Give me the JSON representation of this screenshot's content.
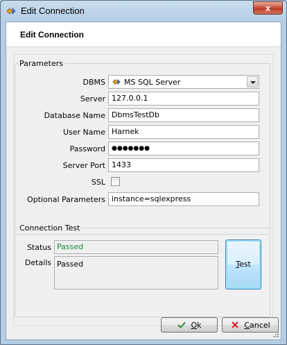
{
  "window": {
    "title": "Edit Connection",
    "close_label": "x"
  },
  "header": {
    "title": "Edit Connection"
  },
  "parameters": {
    "legend": "Parameters",
    "dbms": {
      "label": "DBMS",
      "value": "MS SQL Server"
    },
    "server": {
      "label": "Server",
      "value": "127.0.0.1"
    },
    "database_name": {
      "label": "Database Name",
      "value": "DbmsTestDb"
    },
    "user_name": {
      "label": "User Name",
      "value": "Harnek"
    },
    "password": {
      "label": "Password",
      "value": "●●●●●●●"
    },
    "server_port": {
      "label": "Server Port",
      "value": "1433"
    },
    "ssl": {
      "label": "SSL",
      "checked": false
    },
    "optional_parameters": {
      "label": "Optional Parameters",
      "value": "instance=sqlexpress"
    }
  },
  "connection_test": {
    "legend": "Connection Test",
    "status_label": "Status",
    "status_value": "Passed",
    "details_label": "Details",
    "details_value": "Passed",
    "test_button_prefix": "",
    "test_button_mnemonic": "T",
    "test_button_rest": "est"
  },
  "footer": {
    "ok_mnemonic": "O",
    "ok_rest": "k",
    "cancel_mnemonic": "C",
    "cancel_rest": "ancel"
  },
  "colors": {
    "status_passed": "#1a8a3a",
    "ok_icon": "#2e8b2e",
    "cancel_icon": "#d02020"
  }
}
